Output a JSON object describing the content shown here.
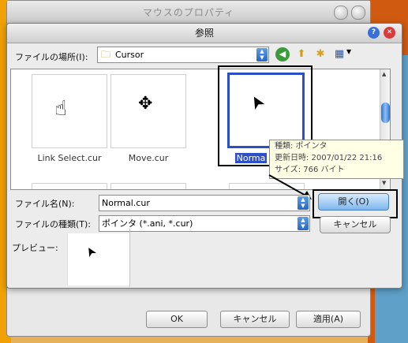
{
  "back_window": {
    "title": "マウスのプロパティ",
    "ok_label": "OK",
    "cancel_label": "キャンセル",
    "apply_label": "適用(A)"
  },
  "dialog": {
    "title": "参照",
    "look_in_label": "ファイルの場所(I):",
    "look_in_value": "Cursor",
    "filename_label": "ファイル名(N):",
    "filename_value": "Normal.cur",
    "filetype_label": "ファイルの種類(T):",
    "filetype_value": "ポインタ (*.ani, *.cur)",
    "open_label": "開く(O)",
    "cancel_label": "キャンセル",
    "preview_label": "プレビュー:"
  },
  "files": [
    {
      "caption": "Link Select.cur",
      "icon": "hand-pointer-icon",
      "glyph": "☝"
    },
    {
      "caption": "Move.cur",
      "icon": "move-arrows-icon",
      "glyph": "✥"
    },
    {
      "caption": "Normal.cur",
      "caption_visible": "Norma",
      "icon": "arrow-pointer-icon",
      "glyph": "➤",
      "selected": true
    }
  ],
  "tooltip": {
    "type_line": "種類: ポインタ",
    "date_line": "更新日時: 2007/01/22 21:16",
    "size_line": "サイズ: 766 バイト"
  },
  "colors": {
    "selection": "#2b4fc6",
    "default_button": "#7fb7ef",
    "close_button": "#d83b3b",
    "help_button": "#3a6fd8"
  }
}
